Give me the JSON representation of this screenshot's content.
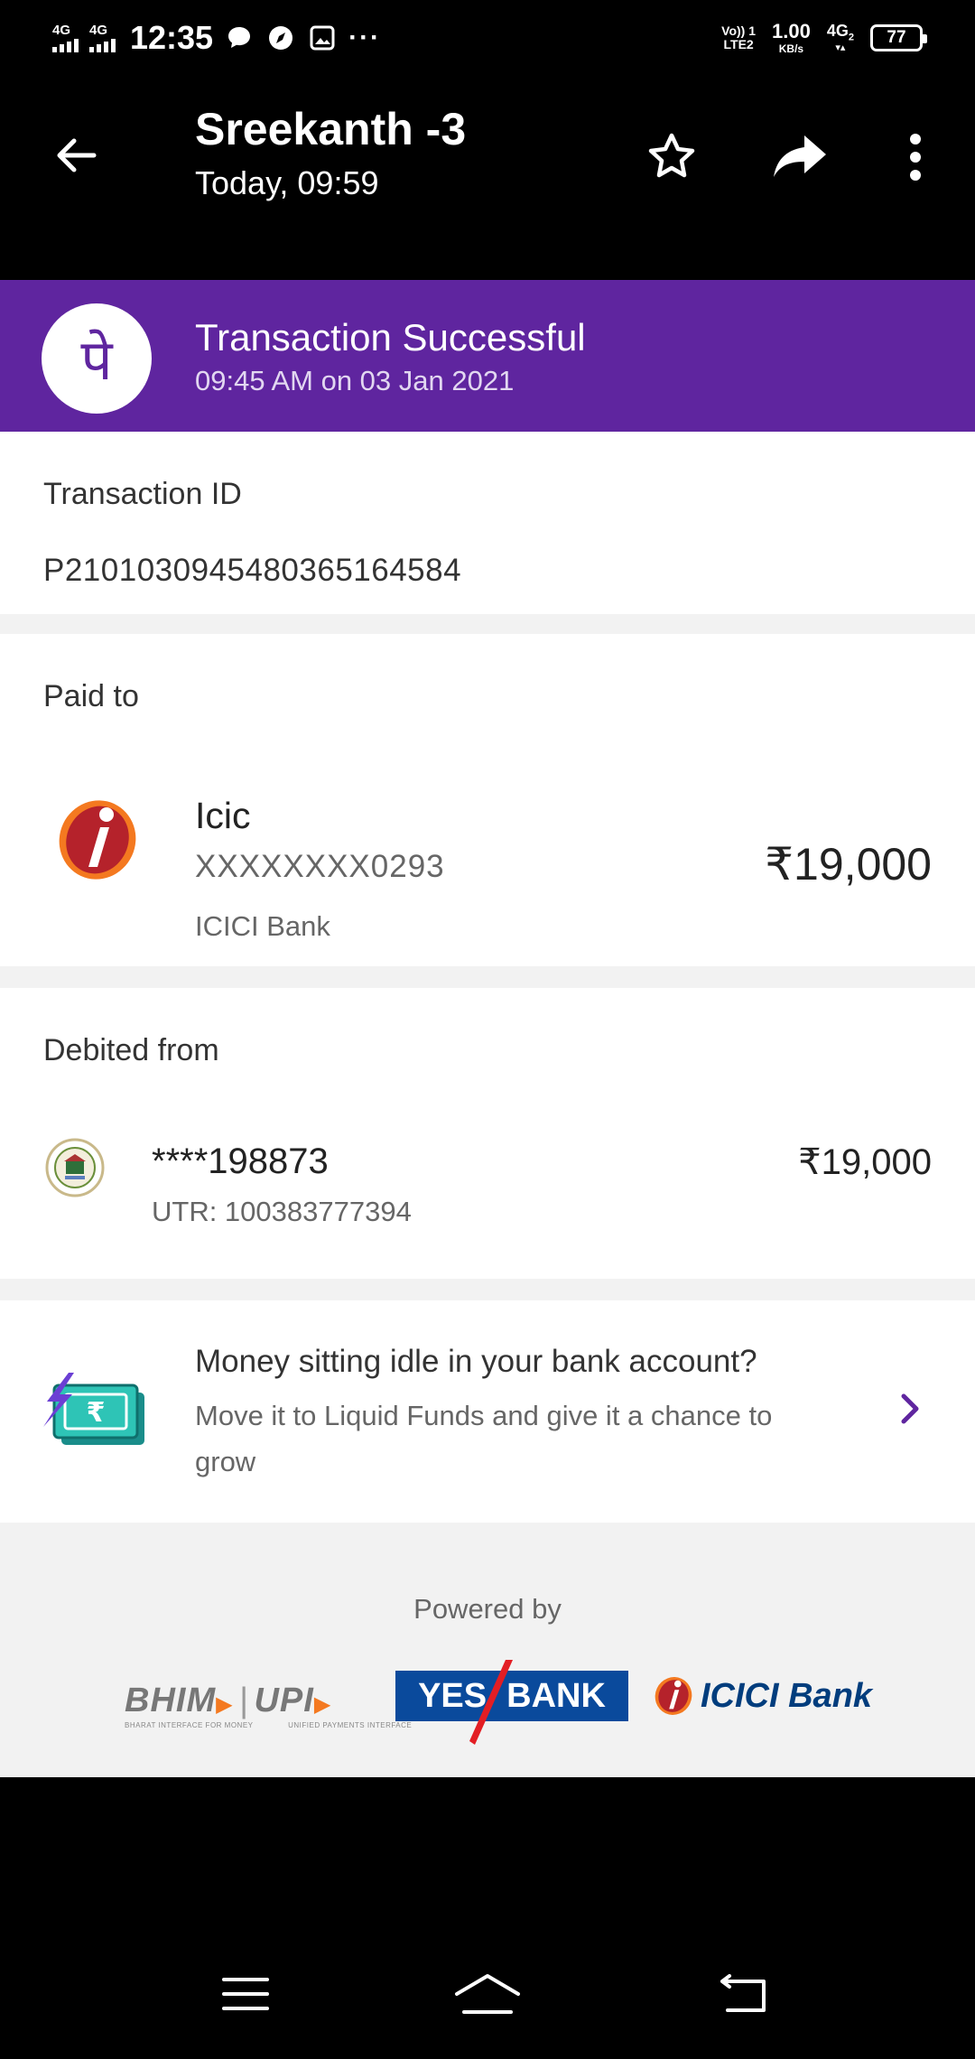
{
  "status_bar": {
    "sim1_label": "4G",
    "sim2_label": "4G",
    "time": "12:35",
    "volte_label_top": "Vo)) 1",
    "volte_label_bottom": "LTE2",
    "speed_value": "1.00",
    "speed_unit": "KB/s",
    "network_label": "4G",
    "network_sub": "2",
    "battery": "77",
    "icons": [
      "chat-bubble-icon",
      "compass-icon",
      "gallery-icon",
      "more-dots-icon"
    ]
  },
  "app_bar": {
    "title": "Sreekanth -3",
    "subtitle": "Today, 09:59",
    "icons": [
      "back-arrow-icon",
      "star-icon",
      "share-icon",
      "overflow-menu-icon"
    ]
  },
  "banner": {
    "logo_glyph": "पे",
    "title": "Transaction Successful",
    "subtitle": "09:45 AM on 03 Jan 2021",
    "color": "#5f259f"
  },
  "transaction": {
    "label": "Transaction ID",
    "id": "P2101030945480365164584"
  },
  "paid_to": {
    "label": "Paid to",
    "name": "Icic",
    "account": "XXXXXXXX0293",
    "bank": "ICICI Bank",
    "amount": "₹19,000"
  },
  "debited_from": {
    "label": "Debited from",
    "account": "****198873",
    "utr": "UTR: 100383777394",
    "amount": "₹19,000"
  },
  "promo": {
    "title": "Money sitting idle in your bank account?",
    "text": "Move it to Liquid Funds and give it a chance to grow",
    "accent": "#5f259f"
  },
  "powered_by": {
    "label": "Powered by",
    "bhim": "BHIM",
    "upi": "UPI",
    "bhim_tagline": "BHARAT INTERFACE FOR MONEY",
    "upi_tagline": "UNIFIED PAYMENTS INTERFACE",
    "yes_left": "YES",
    "yes_right": "BANK",
    "icici": "ICICI Bank"
  },
  "nav_bar": {
    "icons": [
      "menu-icon",
      "home-icon",
      "back-icon"
    ]
  }
}
